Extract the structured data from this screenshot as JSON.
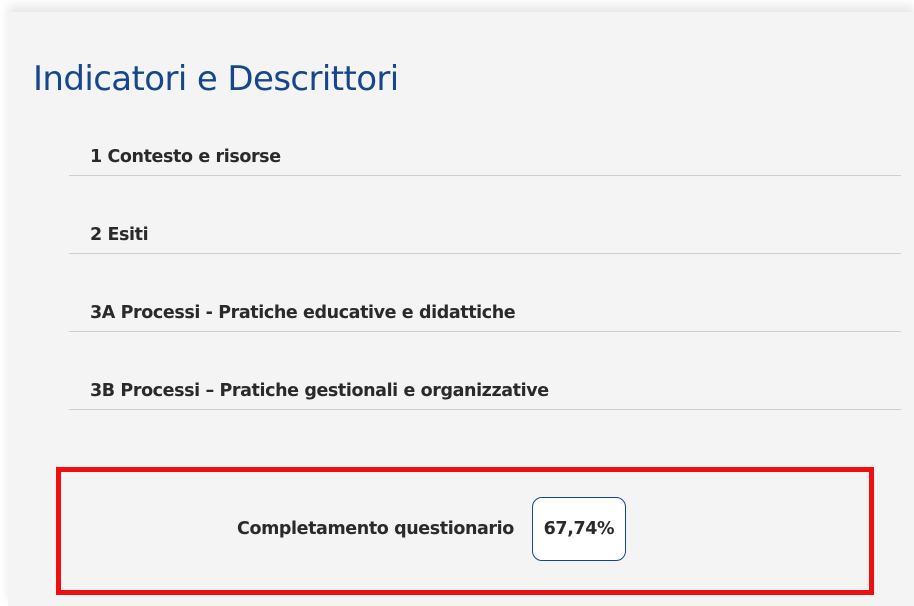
{
  "title": "Indicatori e Descrittori",
  "sections": [
    {
      "label": "1 Contesto e risorse"
    },
    {
      "label": "2 Esiti"
    },
    {
      "label": "3A Processi - Pratiche educative e didattiche"
    },
    {
      "label": "3B Processi – Pratiche gestionali e organizzative"
    }
  ],
  "completion": {
    "label": "Completamento questionario",
    "value": "67,74%",
    "percent": 67.74
  },
  "colors": {
    "title": "#17468c",
    "highlight_border": "#ee1010",
    "panel_background": "#f4f4f4"
  }
}
